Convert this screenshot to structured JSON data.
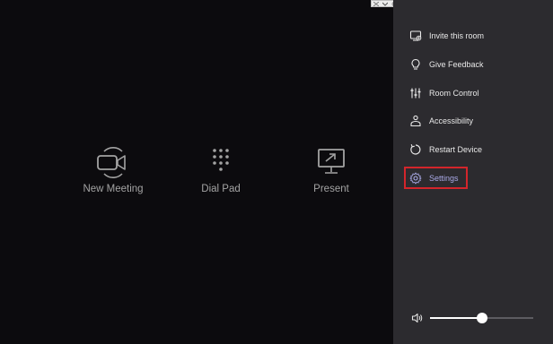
{
  "main": {
    "actions": [
      {
        "label": "New Meeting",
        "icon": "video-camera-icon"
      },
      {
        "label": "Dial Pad",
        "icon": "dialpad-icon"
      },
      {
        "label": "Present",
        "icon": "present-screen-icon"
      }
    ]
  },
  "panel": {
    "items": [
      {
        "label": "Invite this room",
        "icon": "invite-icon"
      },
      {
        "label": "Give Feedback",
        "icon": "lightbulb-icon"
      },
      {
        "label": "Room Control",
        "icon": "sliders-icon"
      },
      {
        "label": "Accessibility",
        "icon": "accessibility-icon"
      },
      {
        "label": "Restart Device",
        "icon": "restart-icon"
      },
      {
        "label": "Settings",
        "icon": "gear-icon",
        "selected": true
      }
    ],
    "volume": {
      "icon": "speaker-icon",
      "level_percent": 50
    }
  },
  "colors": {
    "background": "#0c0b0e",
    "panel": "#2c2b2f",
    "text_muted": "#a3a3a3",
    "selected_text": "#a9a9e6",
    "highlight_border": "#d3252b"
  }
}
